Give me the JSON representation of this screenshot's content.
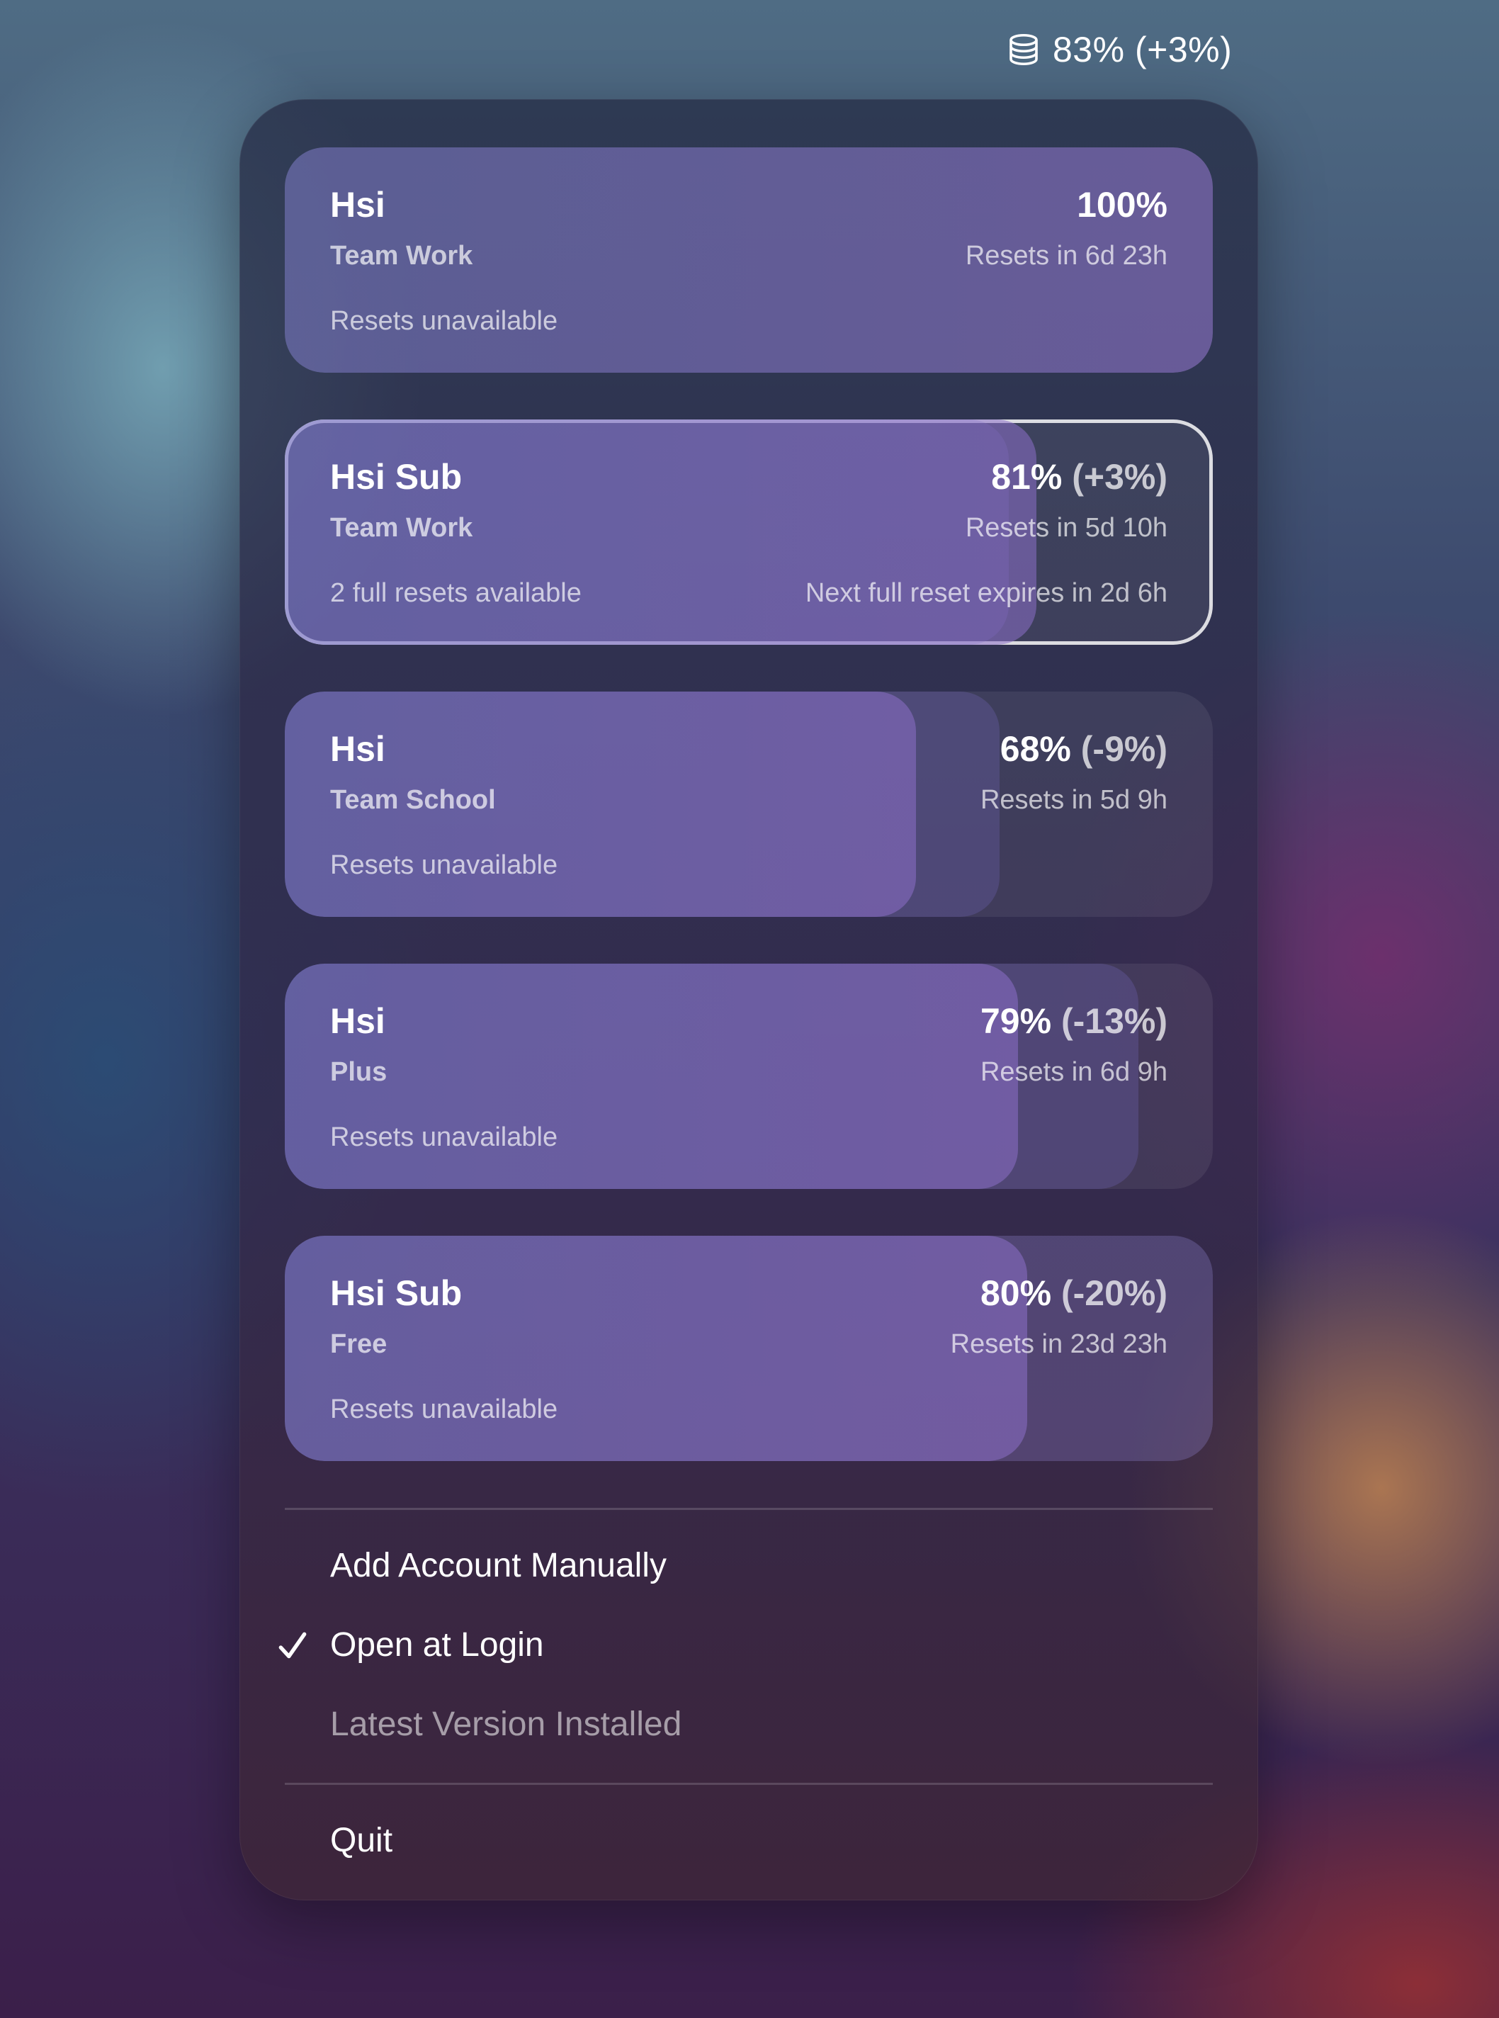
{
  "status_item": {
    "icon": "coins-stack-icon",
    "text": "83% (+3%)"
  },
  "accounts": [
    {
      "name": "Hsi",
      "plan": "Team Work",
      "percent": "100%",
      "delta": "",
      "resets_in": "Resets in 6d 23h",
      "resets_available": "Resets unavailable",
      "next_reset": "",
      "selected": false
    },
    {
      "name": "Hsi Sub",
      "plan": "Team Work",
      "percent": "81%",
      "delta": "(+3%)",
      "resets_in": "Resets in 5d 10h",
      "resets_available": "2 full resets available",
      "next_reset": "Next full reset expires in 2d 6h",
      "selected": true
    },
    {
      "name": "Hsi",
      "plan": "Team School",
      "percent": "68%",
      "delta": "(-9%)",
      "resets_in": "Resets in 5d 9h",
      "resets_available": "Resets unavailable",
      "next_reset": "",
      "selected": false
    },
    {
      "name": "Hsi",
      "plan": "Plus",
      "percent": "79%",
      "delta": "(-13%)",
      "resets_in": "Resets in 6d 9h",
      "resets_available": "Resets unavailable",
      "next_reset": "",
      "selected": false
    },
    {
      "name": "Hsi Sub",
      "plan": "Free",
      "percent": "80%",
      "delta": "(-20%)",
      "resets_in": "Resets in 23d 23h",
      "resets_available": "Resets unavailable",
      "next_reset": "",
      "selected": false
    }
  ],
  "usage_bars": [
    {
      "current": 1.0,
      "previous": null
    },
    {
      "current": 0.81,
      "previous": 0.78
    },
    {
      "current": 0.68,
      "previous": 0.77
    },
    {
      "current": 0.79,
      "previous": 0.92
    },
    {
      "current": 0.8,
      "previous": 1.0
    }
  ],
  "menu": {
    "add_account": "Add Account Manually",
    "open_at_login": "Open at Login",
    "open_at_login_checked": true,
    "latest_version": "Latest Version Installed",
    "quit": "Quit"
  }
}
